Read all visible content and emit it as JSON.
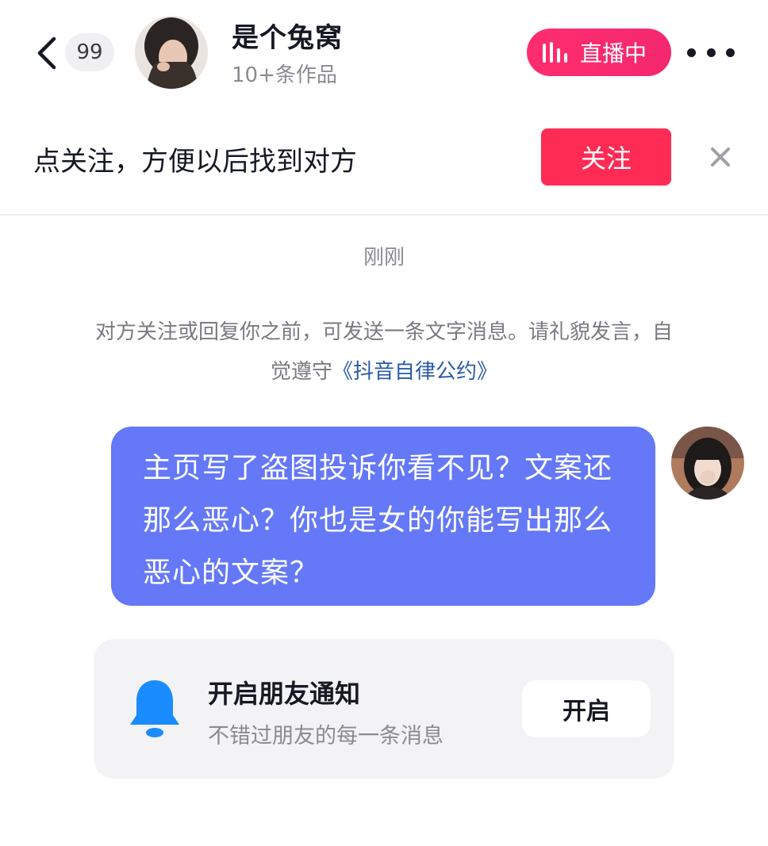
{
  "header": {
    "unread_count": "99",
    "contact_name": "是个兔窝",
    "works_count": "10+条作品",
    "live_label": "直播中"
  },
  "follow_prompt": {
    "text": "点关注，方便以后找到对方",
    "button_label": "关注"
  },
  "chat": {
    "timestamp": "刚刚",
    "notice_text": "对方关注或回复你之前，可发送一条文字消息。请礼貌发言，自觉遵守",
    "notice_link": "《抖音自律公约》",
    "messages": [
      {
        "text": "主页写了盗图投诉你看不见？文案还那么恶心？你也是女的你能写出那么恶心的文案？"
      }
    ]
  },
  "notification_card": {
    "title": "开启朋友通知",
    "subtitle": "不错过朋友的每一条消息",
    "button_label": "开启"
  },
  "colors": {
    "follow_button": "#fe2c55",
    "live_badge": "#ff2d6e",
    "message_bubble": "#6478f8",
    "bell_icon": "#1a8cff",
    "link": "#2a5aa8"
  },
  "icons": {
    "back": "chevron-left-icon",
    "live": "live-bars-icon",
    "more": "more-dots-icon",
    "close": "close-icon",
    "bell": "bell-icon"
  }
}
